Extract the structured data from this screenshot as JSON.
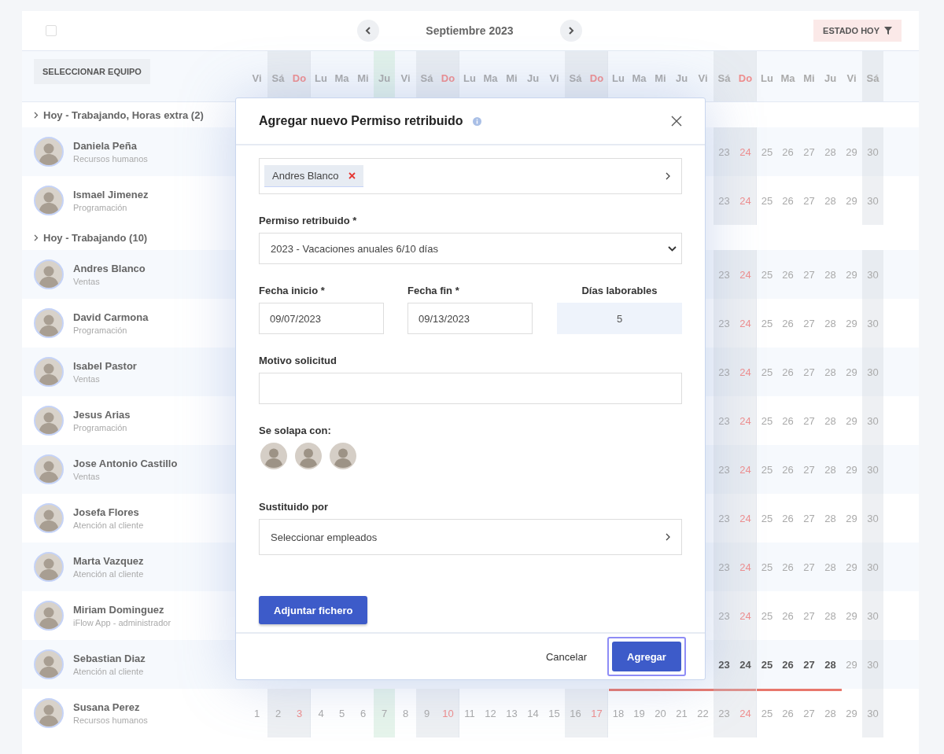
{
  "toolbar": {
    "select_all_checked": false,
    "month": "Septiembre 2023",
    "filter_button": "ESTADO HOY"
  },
  "team_button": "SELECCIONAR EQUIPO",
  "days": [
    {
      "label": "Vi",
      "kind": "weekday"
    },
    {
      "label": "Sá",
      "kind": "saturday"
    },
    {
      "label": "Do",
      "kind": "sunday"
    },
    {
      "label": "Lu",
      "kind": "monday"
    },
    {
      "label": "Ma",
      "kind": "weekday"
    },
    {
      "label": "Mi",
      "kind": "weekday"
    },
    {
      "label": "Ju",
      "kind": "today"
    },
    {
      "label": "Vi",
      "kind": "weekday"
    },
    {
      "label": "Sá",
      "kind": "saturday"
    },
    {
      "label": "Do",
      "kind": "sunday"
    },
    {
      "label": "Lu",
      "kind": "monday"
    },
    {
      "label": "Ma",
      "kind": "weekday"
    },
    {
      "label": "Mi",
      "kind": "weekday"
    },
    {
      "label": "Ju",
      "kind": "weekday"
    },
    {
      "label": "Vi",
      "kind": "weekday"
    },
    {
      "label": "Sá",
      "kind": "saturday"
    },
    {
      "label": "Do",
      "kind": "sunday"
    },
    {
      "label": "Lu",
      "kind": "monday"
    },
    {
      "label": "Ma",
      "kind": "weekday"
    },
    {
      "label": "Mi",
      "kind": "weekday"
    },
    {
      "label": "Ju",
      "kind": "weekday"
    },
    {
      "label": "Vi",
      "kind": "weekday"
    },
    {
      "label": "Sá",
      "kind": "saturday"
    },
    {
      "label": "Do",
      "kind": "sunday"
    },
    {
      "label": "Lu",
      "kind": "monday"
    },
    {
      "label": "Ma",
      "kind": "weekday"
    },
    {
      "label": "Mi",
      "kind": "weekday"
    },
    {
      "label": "Ju",
      "kind": "weekday"
    },
    {
      "label": "Vi",
      "kind": "weekday"
    },
    {
      "label": "Sá",
      "kind": "saturday"
    }
  ],
  "groups": [
    {
      "title": "Hoy - Trabajando, Horas extra (2)",
      "people": [
        {
          "name": "Daniela Peña",
          "department": "Recursos humanos",
          "days": [
            {
              "label": "23",
              "bold": false
            },
            {
              "label": "24",
              "bold": false
            },
            {
              "label": "25",
              "bold": false
            },
            {
              "label": "26",
              "bold": false
            },
            {
              "label": "27",
              "bold": false
            },
            {
              "label": "28",
              "bold": false
            },
            {
              "label": "29",
              "bold": false
            },
            {
              "label": "30",
              "bold": false
            }
          ]
        },
        {
          "name": "Ismael Jimenez",
          "department": "Programación",
          "days": [
            {
              "label": "23",
              "bold": false
            },
            {
              "label": "24",
              "bold": false
            },
            {
              "label": "25",
              "bold": false
            },
            {
              "label": "26",
              "bold": false
            },
            {
              "label": "27",
              "bold": false
            },
            {
              "label": "28",
              "bold": false
            },
            {
              "label": "29",
              "bold": false
            },
            {
              "label": "30",
              "bold": false
            }
          ]
        }
      ]
    },
    {
      "title": "Hoy - Trabajando (10)",
      "people": [
        {
          "name": "Andres Blanco",
          "department": "Ventas",
          "days": [
            {
              "label": "23",
              "bold": false
            },
            {
              "label": "24",
              "bold": false
            },
            {
              "label": "25",
              "bold": false
            },
            {
              "label": "26",
              "bold": false
            },
            {
              "label": "27",
              "bold": false
            },
            {
              "label": "28",
              "bold": false
            },
            {
              "label": "29",
              "bold": false
            },
            {
              "label": "30",
              "bold": false
            }
          ]
        },
        {
          "name": "David Carmona",
          "department": "Programación",
          "days": [
            {
              "label": "23",
              "bold": false
            },
            {
              "label": "24",
              "bold": false
            },
            {
              "label": "25",
              "bold": false
            },
            {
              "label": "26",
              "bold": false
            },
            {
              "label": "27",
              "bold": false
            },
            {
              "label": "28",
              "bold": false
            },
            {
              "label": "29",
              "bold": false
            },
            {
              "label": "30",
              "bold": false
            }
          ]
        },
        {
          "name": "Isabel Pastor",
          "department": "Ventas",
          "days": [
            {
              "label": "23",
              "bold": false
            },
            {
              "label": "24",
              "bold": false
            },
            {
              "label": "25",
              "bold": false
            },
            {
              "label": "26",
              "bold": false
            },
            {
              "label": "27",
              "bold": false
            },
            {
              "label": "28",
              "bold": false
            },
            {
              "label": "29",
              "bold": false
            },
            {
              "label": "30",
              "bold": false
            }
          ]
        },
        {
          "name": "Jesus Arias",
          "department": "Programación",
          "days": [
            {
              "label": "23",
              "bold": false
            },
            {
              "label": "24",
              "bold": false
            },
            {
              "label": "25",
              "bold": false
            },
            {
              "label": "26",
              "bold": false
            },
            {
              "label": "27",
              "bold": false
            },
            {
              "label": "28",
              "bold": false
            },
            {
              "label": "29",
              "bold": false
            },
            {
              "label": "30",
              "bold": false
            }
          ]
        },
        {
          "name": "Jose Antonio Castillo",
          "department": "Ventas",
          "days": [
            {
              "label": "23",
              "bold": false
            },
            {
              "label": "24",
              "bold": false
            },
            {
              "label": "25",
              "bold": false
            },
            {
              "label": "26",
              "bold": false
            },
            {
              "label": "27",
              "bold": false
            },
            {
              "label": "28",
              "bold": false
            },
            {
              "label": "29",
              "bold": false
            },
            {
              "label": "30",
              "bold": false
            }
          ]
        },
        {
          "name": "Josefa Flores",
          "department": "Atención al cliente",
          "days": [
            {
              "label": "23",
              "bold": false
            },
            {
              "label": "24",
              "bold": false
            },
            {
              "label": "25",
              "bold": false
            },
            {
              "label": "26",
              "bold": false
            },
            {
              "label": "27",
              "bold": false
            },
            {
              "label": "28",
              "bold": false
            },
            {
              "label": "29",
              "bold": false
            },
            {
              "label": "30",
              "bold": false
            }
          ]
        },
        {
          "name": "Marta Vazquez",
          "department": "Atención al cliente",
          "days": [
            {
              "label": "23",
              "bold": false
            },
            {
              "label": "24",
              "bold": false
            },
            {
              "label": "25",
              "bold": false
            },
            {
              "label": "26",
              "bold": false
            },
            {
              "label": "27",
              "bold": false
            },
            {
              "label": "28",
              "bold": false
            },
            {
              "label": "29",
              "bold": false
            },
            {
              "label": "30",
              "bold": false
            }
          ]
        },
        {
          "name": "Miriam Dominguez",
          "department": "iFlow App - administrador",
          "days": [
            {
              "label": "23",
              "bold": false
            },
            {
              "label": "24",
              "bold": false
            },
            {
              "label": "25",
              "bold": false
            },
            {
              "label": "26",
              "bold": false
            },
            {
              "label": "27",
              "bold": false
            },
            {
              "label": "28",
              "bold": false
            },
            {
              "label": "29",
              "bold": false
            },
            {
              "label": "30",
              "bold": false
            }
          ]
        },
        {
          "name": "Sebastian Diaz",
          "department": "Atención al cliente",
          "leave_bar": true,
          "days": [
            {
              "label": "23",
              "bold": true
            },
            {
              "label": "24",
              "bold": true
            },
            {
              "label": "25",
              "bold": true
            },
            {
              "label": "26",
              "bold": true
            },
            {
              "label": "27",
              "bold": true
            },
            {
              "label": "28",
              "bold": true
            },
            {
              "label": "29",
              "bold": false
            },
            {
              "label": "30",
              "bold": false
            }
          ]
        },
        {
          "name": "Susana Perez",
          "department": "Recursos humanos",
          "days": [
            {
              "label": "1",
              "bold": false
            },
            {
              "label": "2",
              "bold": false
            },
            {
              "label": "3",
              "bold": false
            },
            {
              "label": "4",
              "bold": false
            },
            {
              "label": "5",
              "bold": false
            },
            {
              "label": "6",
              "bold": false
            },
            {
              "label": "7",
              "bold": false
            },
            {
              "label": "8",
              "bold": false
            },
            {
              "label": "9",
              "bold": false
            },
            {
              "label": "10",
              "bold": false
            },
            {
              "label": "11",
              "bold": false
            },
            {
              "label": "12",
              "bold": false
            },
            {
              "label": "13",
              "bold": false
            },
            {
              "label": "14",
              "bold": false
            },
            {
              "label": "15",
              "bold": false
            },
            {
              "label": "16",
              "bold": false
            },
            {
              "label": "17",
              "bold": false
            },
            {
              "label": "18",
              "bold": false
            },
            {
              "label": "19",
              "bold": false
            },
            {
              "label": "20",
              "bold": false
            },
            {
              "label": "21",
              "bold": false
            },
            {
              "label": "22",
              "bold": false
            },
            {
              "label": "23",
              "bold": false
            },
            {
              "label": "24",
              "bold": false
            },
            {
              "label": "25",
              "bold": false
            },
            {
              "label": "26",
              "bold": false
            },
            {
              "label": "27",
              "bold": false
            },
            {
              "label": "28",
              "bold": false
            },
            {
              "label": "29",
              "bold": false
            },
            {
              "label": "30",
              "bold": false
            }
          ]
        }
      ]
    }
  ],
  "dialog": {
    "title": "Agregar nuevo Permiso retribuido",
    "employee_chip": "Andres Blanco",
    "leave_type_label": "Permiso retribuido *",
    "leave_type_value": "2023 - Vacaciones anuales 6/10 días",
    "start_label": "Fecha inicio *",
    "start_value": "09/07/2023",
    "end_label": "Fecha fin *",
    "end_value": "09/13/2023",
    "workdays_label": "Días laborables",
    "workdays_value": "5",
    "reason_label": "Motivo solicitud",
    "overlap_label": "Se solapa con:",
    "overlap_people": [
      {
        "kind": "avatar"
      },
      {
        "kind": "avatar"
      },
      {
        "kind": "avatar"
      }
    ],
    "substitute_label": "Sustituido por",
    "substitute_value": "Seleccionar empleados",
    "attach_button": "Adjuntar fichero",
    "cancel_button": "Cancelar",
    "submit_button": "Agregar",
    "submit_focused": true
  }
}
